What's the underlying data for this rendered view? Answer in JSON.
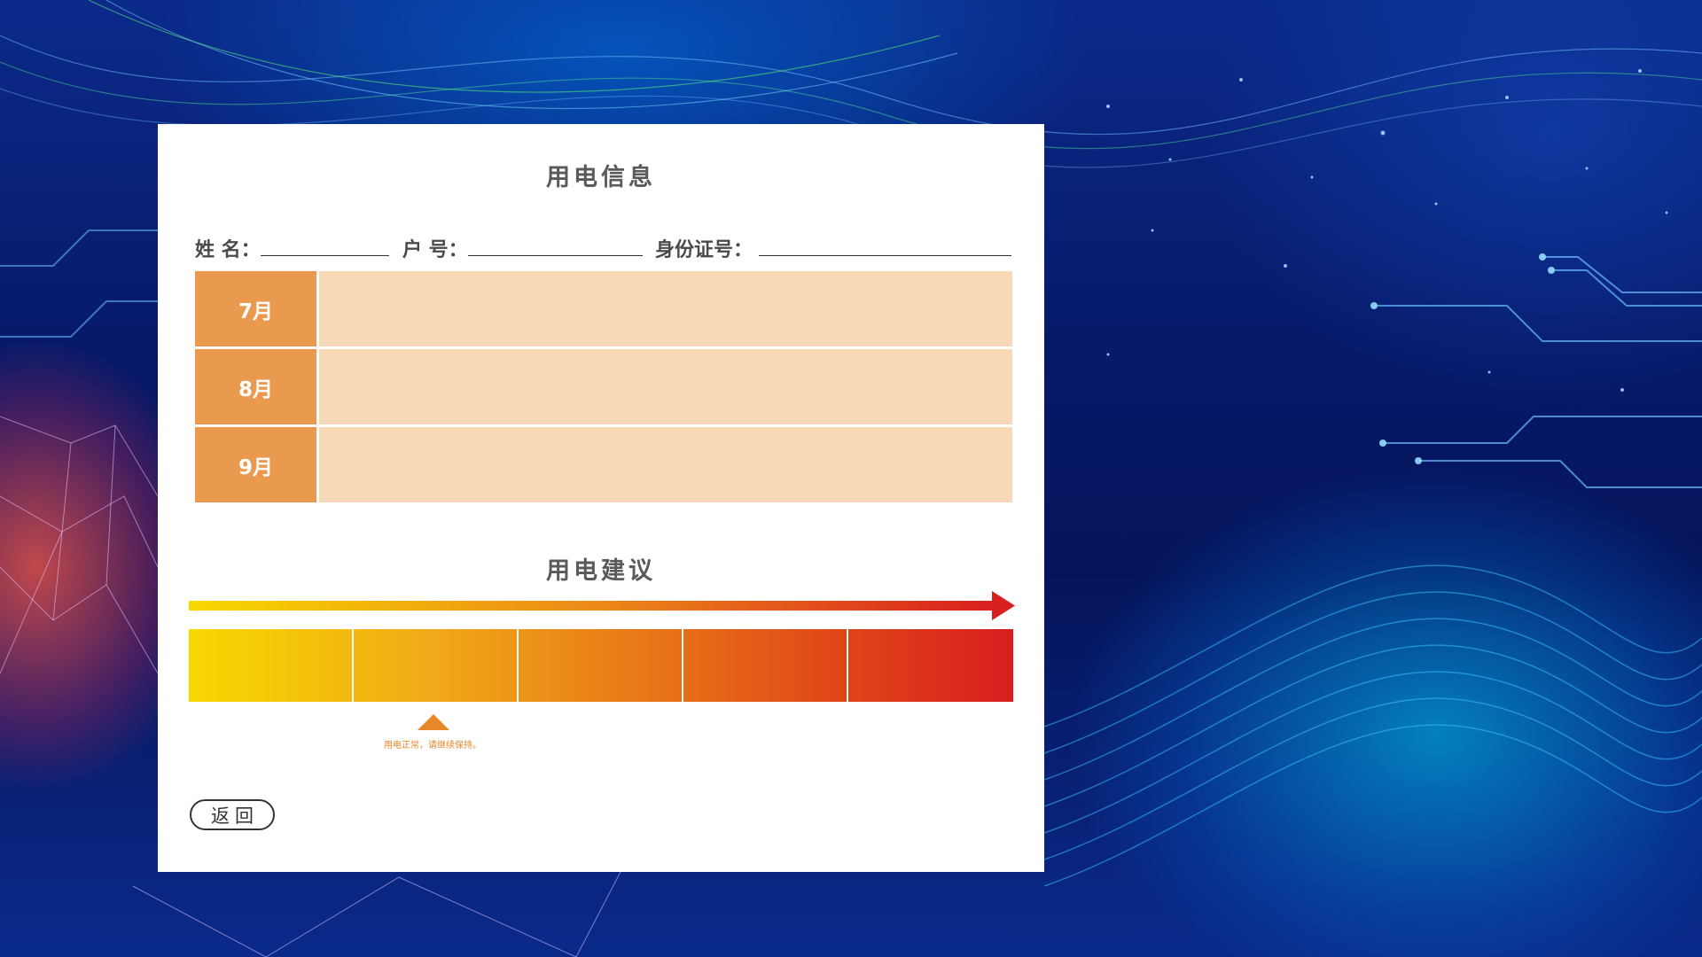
{
  "info": {
    "title": "用电信息",
    "fields": {
      "name_label": "姓 名：",
      "name_value": "",
      "account_label": "户 号：",
      "account_value": "",
      "id_label": "身份证号：",
      "id_value": ""
    },
    "months": [
      {
        "label": "7月",
        "value": ""
      },
      {
        "label": "8月",
        "value": ""
      },
      {
        "label": "9月",
        "value": ""
      }
    ]
  },
  "advice": {
    "title": "用电建议",
    "scale_segments": 5,
    "marker_segment": 2,
    "message": "用电正常，请继续保持。",
    "colors": {
      "start": "#f8d800",
      "end": "#d81e1e",
      "marker": "#e8862a"
    }
  },
  "actions": {
    "back_label": "返回"
  },
  "colors": {
    "month_label_bg": "#ea9a4e",
    "month_value_bg": "#f8d9b7",
    "title_text": "#5a5a5a"
  }
}
